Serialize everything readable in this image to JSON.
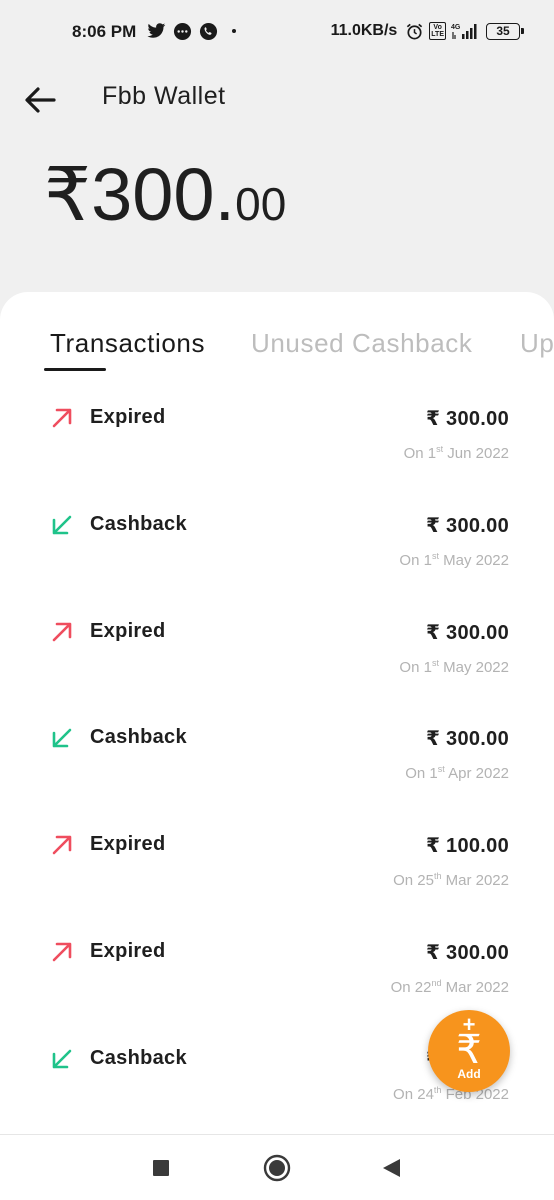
{
  "status_bar": {
    "time": "8:06 PM",
    "net_speed": "11.0KB/s",
    "volte": "Vo LTE",
    "network": "4G",
    "battery": "35",
    "icons": [
      "twitter-icon",
      "messages-icon",
      "phone-icon",
      "alarm-icon",
      "signal-icon",
      "battery-icon"
    ]
  },
  "header": {
    "title": "Fbb Wallet"
  },
  "balance": {
    "currency": "₹",
    "integer": "300.",
    "decimal": "00"
  },
  "tabs": [
    {
      "label": "Transactions",
      "active": true
    },
    {
      "label": "Unused Cashback",
      "active": false
    },
    {
      "label": "Up",
      "active": false
    }
  ],
  "transactions": [
    {
      "type": "Expired",
      "direction": "out",
      "amount": "₹ 300.00",
      "date_prefix": "On 1",
      "date_sup": "st",
      "date_suffix": " Jun 2022"
    },
    {
      "type": "Cashback",
      "direction": "in",
      "amount": "₹ 300.00",
      "date_prefix": "On 1",
      "date_sup": "st",
      "date_suffix": " May 2022"
    },
    {
      "type": "Expired",
      "direction": "out",
      "amount": "₹ 300.00",
      "date_prefix": "On 1",
      "date_sup": "st",
      "date_suffix": " May 2022"
    },
    {
      "type": "Cashback",
      "direction": "in",
      "amount": "₹ 300.00",
      "date_prefix": "On 1",
      "date_sup": "st",
      "date_suffix": " Apr 2022"
    },
    {
      "type": "Expired",
      "direction": "out",
      "amount": "₹ 100.00",
      "date_prefix": "On 25",
      "date_sup": "th",
      "date_suffix": " Mar 2022"
    },
    {
      "type": "Expired",
      "direction": "out",
      "amount": "₹ 300.00",
      "date_prefix": "On 22",
      "date_sup": "nd",
      "date_suffix": " Mar 2022"
    },
    {
      "type": "Cashback",
      "direction": "in",
      "amount": "₹ 300.00",
      "date_prefix": "On 24",
      "date_sup": "th",
      "date_suffix": " Feb 2022"
    }
  ],
  "fab": {
    "plus": "+",
    "symbol": "₹",
    "label": "Add"
  },
  "colors": {
    "expired": "#ef4d5e",
    "cashback": "#1fc38a",
    "fab": "#f7941d",
    "accent_text": "#1f1f1f"
  }
}
